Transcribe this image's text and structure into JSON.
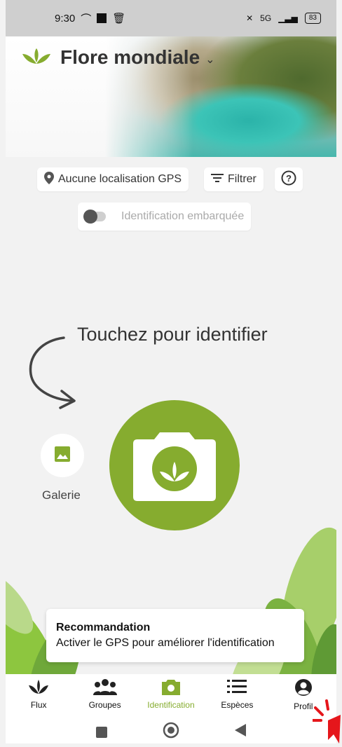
{
  "status_bar": {
    "time": "9:30",
    "network": "5G",
    "battery": "83"
  },
  "header": {
    "title": "Flore mondiale"
  },
  "filters": {
    "gps_label": "Aucune localisation GPS",
    "filter_label": "Filtrer",
    "offline_label": "Identification embarquée"
  },
  "main": {
    "cta_text": "Touchez pour identifier",
    "gallery_label": "Galerie"
  },
  "toast": {
    "title": "Recommandation",
    "message": "Activer le GPS pour améliorer l'identification"
  },
  "nav": {
    "items": [
      {
        "label": "Flux",
        "icon": "leaves-icon"
      },
      {
        "label": "Groupes",
        "icon": "group-icon"
      },
      {
        "label": "Identification",
        "icon": "camera-icon"
      },
      {
        "label": "Espèces",
        "icon": "list-icon"
      },
      {
        "label": "Profil",
        "icon": "profile-icon"
      }
    ]
  },
  "colors": {
    "accent": "#86ac2f",
    "text": "#333333"
  }
}
